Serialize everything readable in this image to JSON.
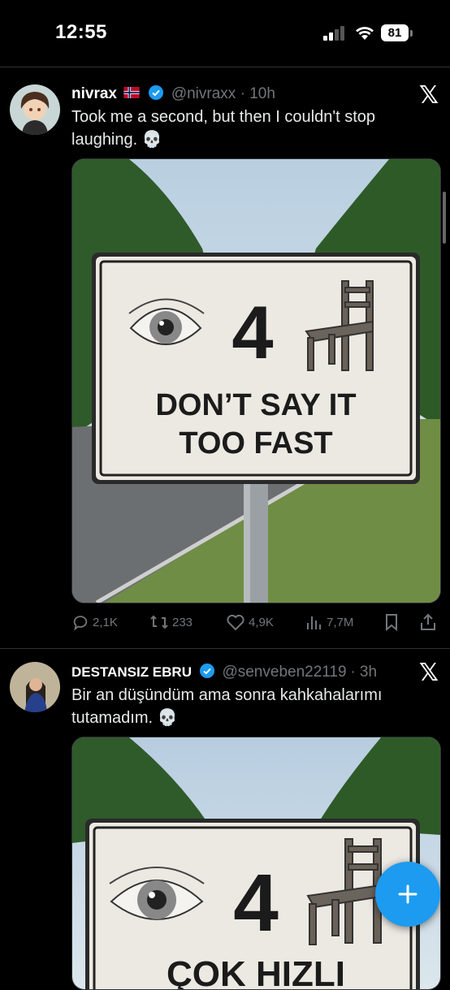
{
  "status_bar": {
    "time": "12:55",
    "battery": "81"
  },
  "tweets": [
    {
      "display_name": "nivrax",
      "handle": "@nivraxx",
      "time": "· 10h",
      "text": "Took me a second, but then I couldn't stop laughing. 💀",
      "sign": {
        "number": "4",
        "line1": "DON’T SAY IT",
        "line2": "TOO FAST"
      },
      "actions": {
        "replies": "2,1K",
        "reposts": "233",
        "likes": "4,9K",
        "views": "7,7M"
      }
    },
    {
      "display_name": "DESTANSIZ EBRU",
      "handle": "@senveben22119",
      "time": "· 3h",
      "text": "Bir an düşündüm ama sonra kahkahalarımı tutamadım. 💀",
      "sign": {
        "number": "4",
        "line1": "ÇOK HIZLI"
      }
    }
  ],
  "icons": [
    "signal-icon",
    "wifi-icon",
    "battery-icon",
    "verified-icon",
    "norway-flag-icon",
    "x-logo-icon",
    "reply-icon",
    "repost-icon",
    "like-icon",
    "views-icon",
    "bookmark-icon",
    "share-icon",
    "compose-plus-icon"
  ],
  "colors": {
    "background": "#000000",
    "accent": "#1d9bf0",
    "muted": "#71767b",
    "text": "#e7e9ea"
  }
}
